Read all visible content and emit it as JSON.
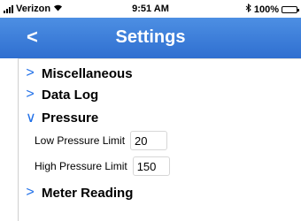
{
  "status": {
    "carrier": "Verizon",
    "time": "9:51 AM",
    "battery": "100%"
  },
  "nav": {
    "back_label": "<",
    "title": "Settings"
  },
  "sections": [
    {
      "label": "Miscellaneous",
      "chevron": ">"
    },
    {
      "label": "Data Log",
      "chevron": ">"
    },
    {
      "label": "Pressure",
      "chevron": "∨"
    },
    {
      "label": "Meter Reading",
      "chevron": ">"
    }
  ],
  "pressure": {
    "low_label": "Low Pressure Limit",
    "low_value": "20",
    "high_label": "High Pressure Limit",
    "high_value": "150"
  }
}
